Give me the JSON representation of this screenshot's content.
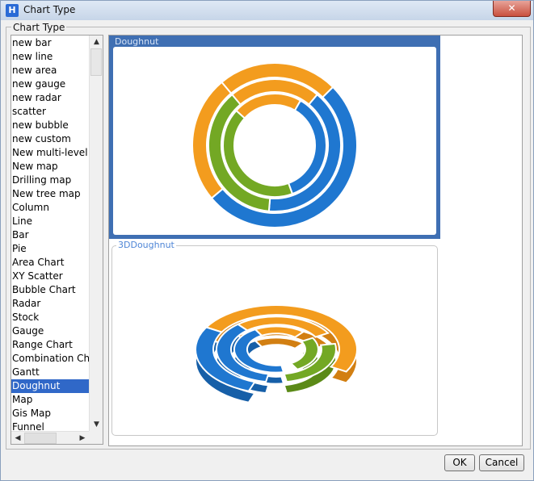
{
  "window": {
    "title": "Chart Type",
    "close_glyph": "✕"
  },
  "group_label": "Chart Type",
  "chart_types": [
    "new bar",
    "new line",
    "new area",
    "new gauge",
    "new radar",
    "scatter",
    "new bubble",
    "new custom",
    "New multi-level p",
    "New map",
    "Drilling map",
    "New tree map",
    "Column",
    "Line",
    "Bar",
    "Pie",
    "Area Chart",
    "XY Scatter",
    "Bubble Chart",
    "Radar",
    "Stock",
    "Gauge",
    "Range Chart",
    "Combination Char",
    "Gantt",
    "Doughnut",
    "Map",
    "Gis Map",
    "Funnel"
  ],
  "selected_index": 25,
  "previews": [
    {
      "label": "Doughnut"
    },
    {
      "label": "3DDoughnut"
    }
  ],
  "buttons": {
    "ok": "OK",
    "cancel": "Cancel"
  },
  "colors": {
    "orange": "#f39c1e",
    "blue": "#1f77d0",
    "green": "#73a824",
    "selection": "#3068c8"
  },
  "icons": {
    "app": "app-logo-icon",
    "up": "scroll-up-icon",
    "down": "scroll-down-icon",
    "left": "scroll-left-icon",
    "right": "scroll-right-icon"
  }
}
